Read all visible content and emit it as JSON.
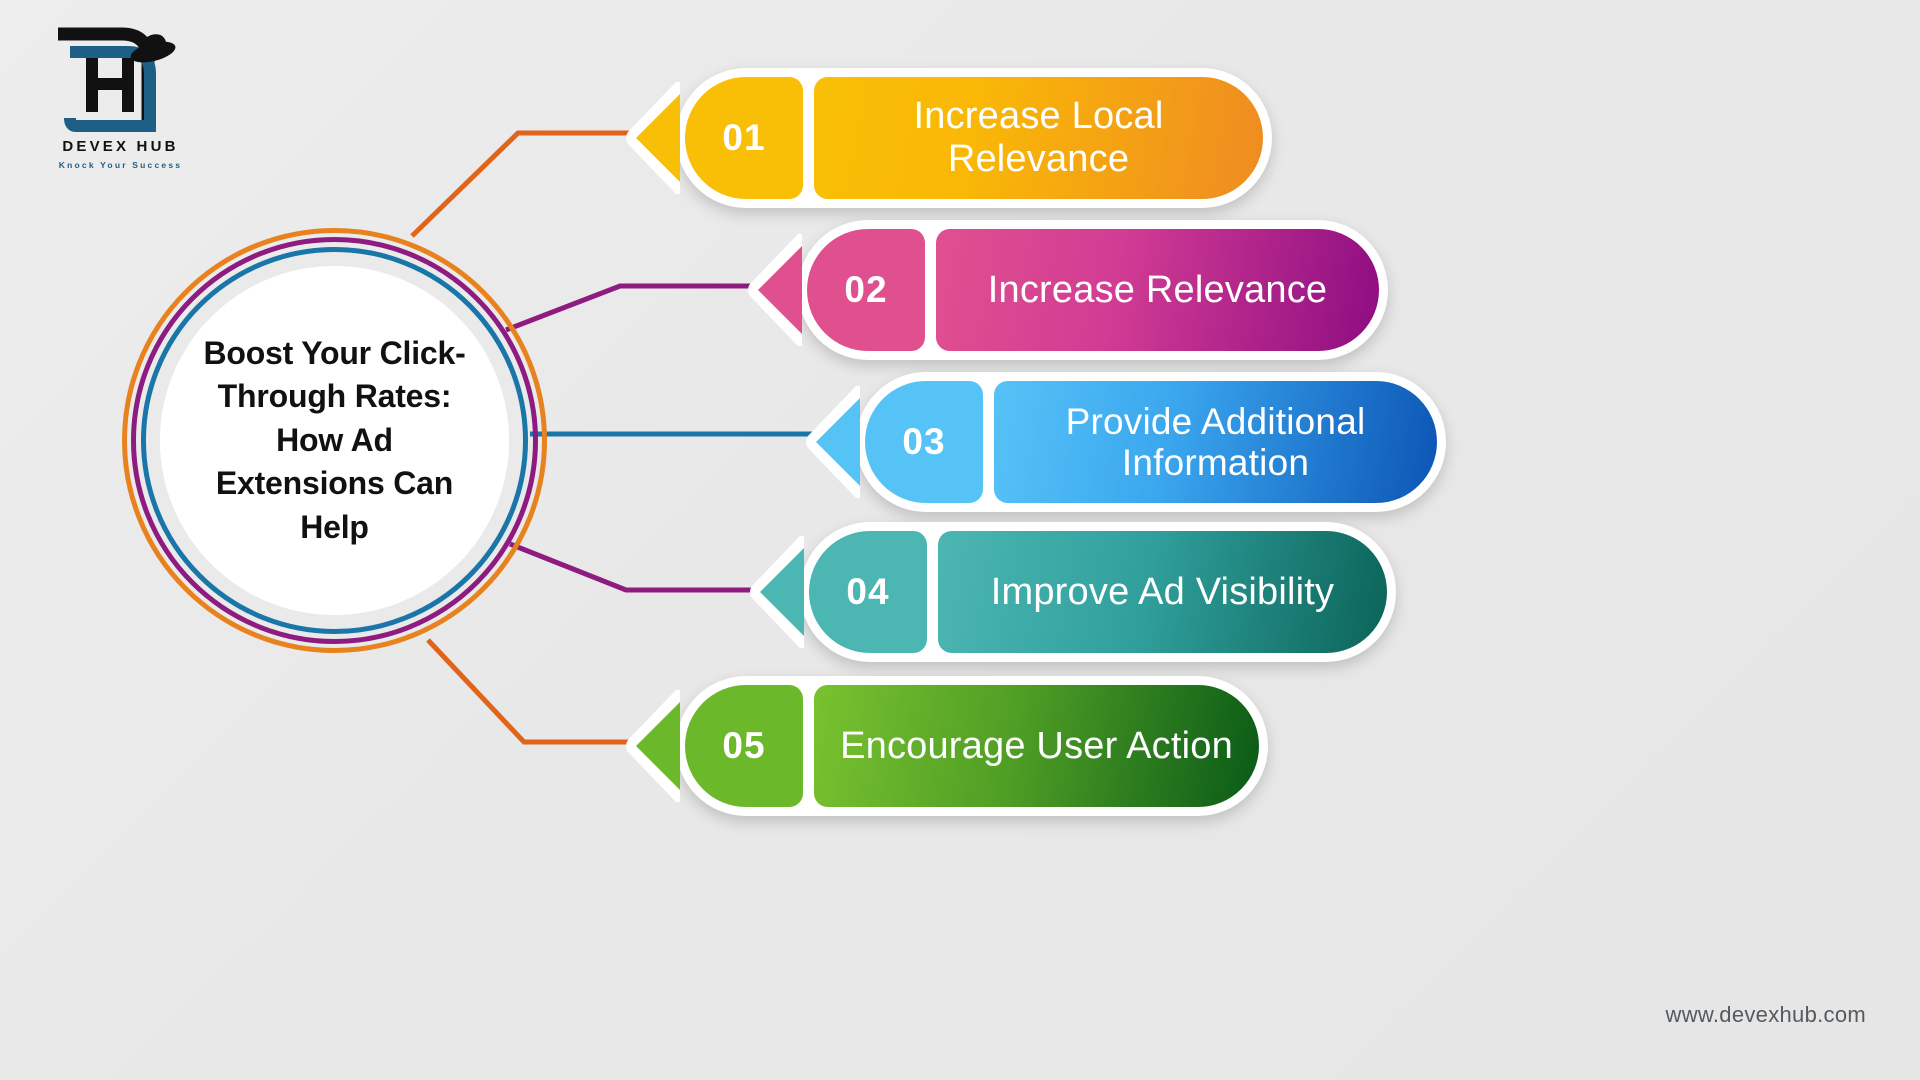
{
  "brand": {
    "logo_icon": "devex-hub-monogram-icon",
    "name": "DEVEX HUB",
    "tagline": "Knock Your Success"
  },
  "hub": {
    "title": "Boost Your Click-Through Rates: How Ad Extensions Can Help",
    "ring_colors": [
      "#e8821e",
      "#8e1b7f",
      "#1a76a8"
    ]
  },
  "cards": [
    {
      "number": "01",
      "label": "Increase Local Relevance",
      "accent": "#f9bf06",
      "accent_end": "#ef8b22",
      "connector_color": "#e0651a"
    },
    {
      "number": "02",
      "label": "Increase Relevance",
      "accent": "#e0508f",
      "accent_end": "#8e0d82",
      "connector_color": "#8e1b7f"
    },
    {
      "number": "03",
      "label": "Provide Additional Information",
      "accent": "#56c3f7",
      "accent_end": "#0c55b5",
      "connector_color": "#1a76a8"
    },
    {
      "number": "04",
      "label": "Improve Ad Visibility",
      "accent": "#4cb6b3",
      "accent_end": "#0b6459",
      "connector_color": "#8e1b7f"
    },
    {
      "number": "05",
      "label": "Encourage User Action",
      "accent": "#6cb82b",
      "accent_end": "#0a5a18",
      "connector_color": "#e0651a"
    }
  ],
  "footer": {
    "website": "www.devexhub.com"
  }
}
